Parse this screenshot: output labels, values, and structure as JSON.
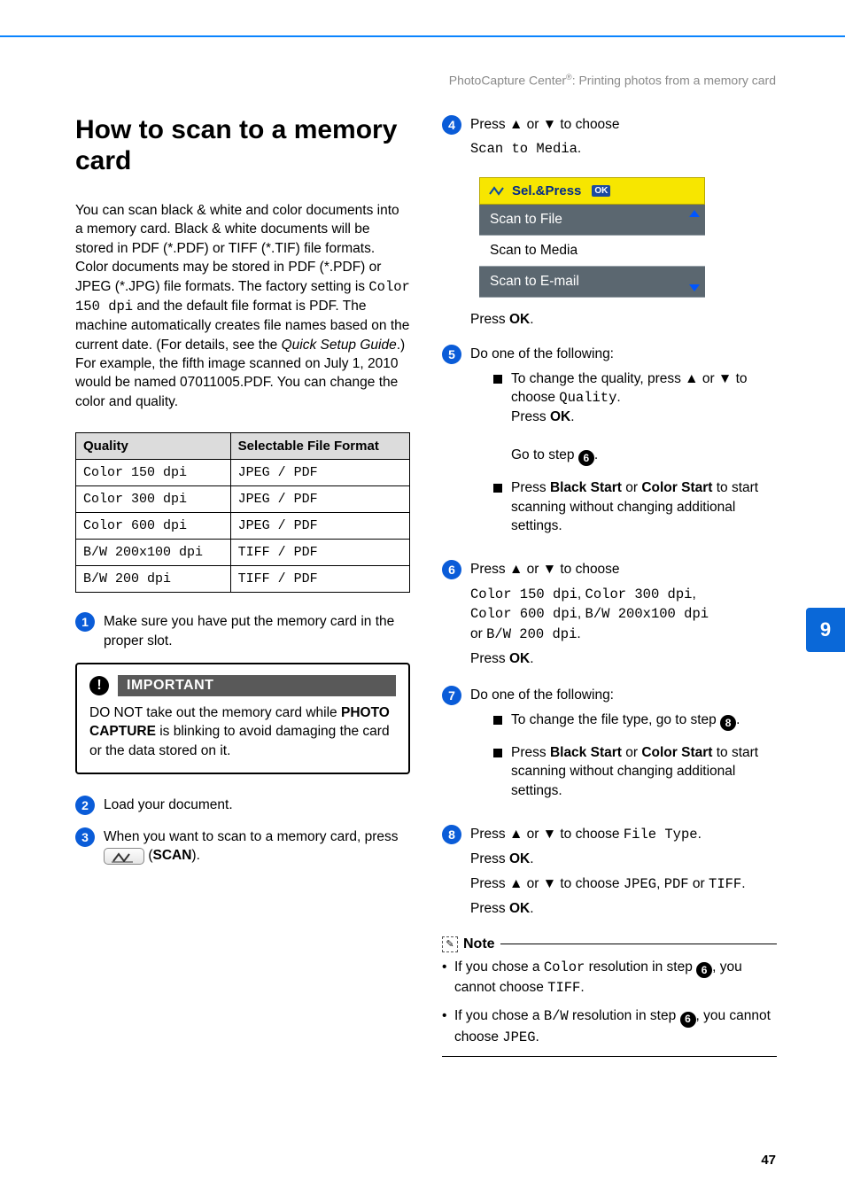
{
  "running_head": {
    "prefix": "PhotoCapture Center",
    "sup": "®",
    "suffix": ": Printing photos from a memory card"
  },
  "h1": "How to scan to a memory card",
  "intro": {
    "p1a": "You can scan black & white and color documents into a memory card. Black & white documents will be stored in PDF (*.PDF) or TIFF (*.TIF) file formats. Color documents may be stored in PDF (*.PDF) or JPEG (*.JPG) file formats. The factory setting is ",
    "code1": "Color 150 dpi",
    "p1b": " and the default file format is PDF. The machine automatically creates file names based on the current date. (For details, see the ",
    "em": "Quick Setup Guide",
    "p1c": ".) For example, the fifth image scanned on July 1, 2010 would be named 07011005.PDF. You can change the color and quality."
  },
  "table": {
    "headers": {
      "c1": "Quality",
      "c2": "Selectable File Format"
    },
    "rows": [
      {
        "q": "Color 150 dpi",
        "f1": "JPEG",
        "sep": " / ",
        "f2": "PDF"
      },
      {
        "q": "Color 300 dpi",
        "f1": "JPEG",
        "sep": " / ",
        "f2": "PDF"
      },
      {
        "q": "Color 600 dpi",
        "f1": "JPEG",
        "sep": " / ",
        "f2": "PDF"
      },
      {
        "q": "B/W 200x100 dpi",
        "f1": "TIFF",
        "sep": " / ",
        "f2": "PDF"
      },
      {
        "q": "B/W 200 dpi",
        "f1": "TIFF",
        "sep": " / ",
        "f2": "PDF"
      }
    ]
  },
  "steps": {
    "s1": {
      "n": "1",
      "t": "Make sure you have put the memory card in the proper slot."
    },
    "s2": {
      "n": "2",
      "t": "Load your document."
    },
    "s3": {
      "n": "3",
      "a": "When you want to scan to a memory card, press ",
      "b": " (",
      "scan": "SCAN",
      "c": ")."
    },
    "s4": {
      "n": "4",
      "lead_a": "Press ",
      "up": "▲",
      "or": " or ",
      "down": "▼",
      "lead_b": " to choose",
      "opt": "Scan to Media",
      "period": ".",
      "press_ok": "Press ",
      "ok": "OK",
      "dot": "."
    },
    "s5": {
      "n": "5",
      "lead": "Do one of the following:",
      "b1_a": "To change the quality, press ",
      "b1_b": " to choose ",
      "quality": "Quality",
      "press": "Press ",
      "ok": "OK",
      "goto_a": "Go to step ",
      "goto_n": "6",
      "goto_b": ".",
      "b2_a": "Press ",
      "bs": "Black Start",
      "b2_b": " or ",
      "cs": "Color Start",
      "b2_c": " to start scanning without changing additional settings."
    },
    "s6": {
      "n": "6",
      "lead_a": "Press ",
      "lead_b": " to choose",
      "o1": "Color 150 dpi",
      "o2": "Color 300 dpi",
      "o3": "Color 600 dpi",
      "o4": "B/W 200x100 dpi",
      "or_word": "or ",
      "o5": "B/W 200 dpi",
      "press": "Press ",
      "ok": "OK"
    },
    "s7": {
      "n": "7",
      "lead": "Do one of the following:",
      "b1_a": "To change the file type, go to step ",
      "b1_n": "8",
      "b1_b": ".",
      "b2_a": "Press ",
      "bs": "Black Start",
      "b2_b": " or ",
      "cs": "Color Start",
      "b2_c": " to start scanning without changing additional settings."
    },
    "s8": {
      "n": "8",
      "l1_a": "Press ",
      "l1_b": " to choose ",
      "ft": "File Type",
      "l1_c": ".",
      "press": "Press ",
      "ok": "OK",
      "l2_a": "Press ",
      "l2_b": " to choose ",
      "jpeg": "JPEG",
      "comma": ", ",
      "pdf": "PDF",
      "or": " or ",
      "tiff": "TIFF",
      "l2_c": "."
    }
  },
  "lcd": {
    "header_a": "Sel.&Press",
    "ok": "OK",
    "r1": "Scan to File",
    "r2": "Scan to Media",
    "r3": "Scan to E-mail"
  },
  "important": {
    "title": "IMPORTANT",
    "a": "DO NOT take out the memory card while ",
    "bold": "PHOTO CAPTURE",
    "b": " is blinking to avoid damaging the card or the data stored on it."
  },
  "note": {
    "title": "Note",
    "n1_a": "If you chose a ",
    "color": "Color",
    "n1_b": " resolution in step ",
    "n1_n": "6",
    "n1_c": ", you cannot choose ",
    "tiff": "TIFF",
    "n1_d": ".",
    "n2_a": "If you chose a ",
    "bw": "B/W",
    "n2_b": " resolution in step ",
    "n2_n": "6",
    "n2_c": ", you cannot choose ",
    "jpeg": "JPEG",
    "n2_d": "."
  },
  "arrows": {
    "up": "▲",
    "down": "▼"
  },
  "side_tab": "9",
  "page_number": "47"
}
